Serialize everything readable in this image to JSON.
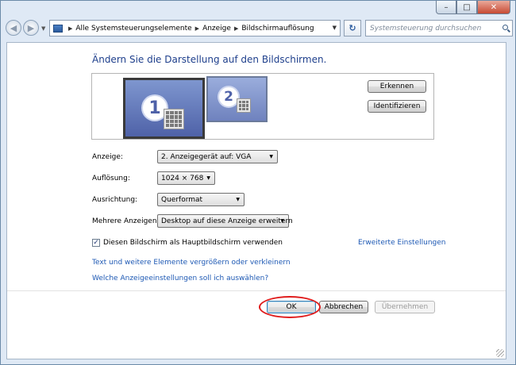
{
  "window": {
    "caption_buttons": {
      "minimize": "–",
      "maximize": "□",
      "close": "✕"
    }
  },
  "nav": {
    "back_icon": "back-arrow-icon",
    "forward_icon": "forward-arrow-icon",
    "breadcrumbs": [
      "Alle Systemsteuerungselemente",
      "Anzeige",
      "Bildschirmauflösung"
    ],
    "search_placeholder": "Systemsteuerung durchsuchen"
  },
  "main": {
    "heading": "Ändern Sie die Darstellung auf den Bildschirmen.",
    "monitors": [
      {
        "number": "1",
        "selected": true
      },
      {
        "number": "2",
        "selected": false
      }
    ],
    "detect_label": "Erkennen",
    "identify_label": "Identifizieren",
    "settings": [
      {
        "label": "Anzeige:",
        "value": "2. Anzeigegerät auf: VGA"
      },
      {
        "label": "Auflösung:",
        "value": "1024 × 768"
      },
      {
        "label": "Ausrichtung:",
        "value": "Querformat"
      },
      {
        "label": "Mehrere Anzeigen:",
        "value": "Desktop auf diese Anzeige erweitern"
      }
    ],
    "primary_checkbox": {
      "label": "Diesen Bildschirm als Hauptbildschirm verwenden",
      "checked": true
    },
    "advanced_link": "Erweiterte Einstellungen",
    "links": [
      "Text und weitere Elemente vergrößern oder verkleinern",
      "Welche Anzeigeeinstellungen soll ich auswählen?"
    ]
  },
  "footer": {
    "ok_label": "OK",
    "cancel_label": "Abbrechen",
    "apply_label": "Übernehmen",
    "highlight_color": "#e01c1c"
  }
}
